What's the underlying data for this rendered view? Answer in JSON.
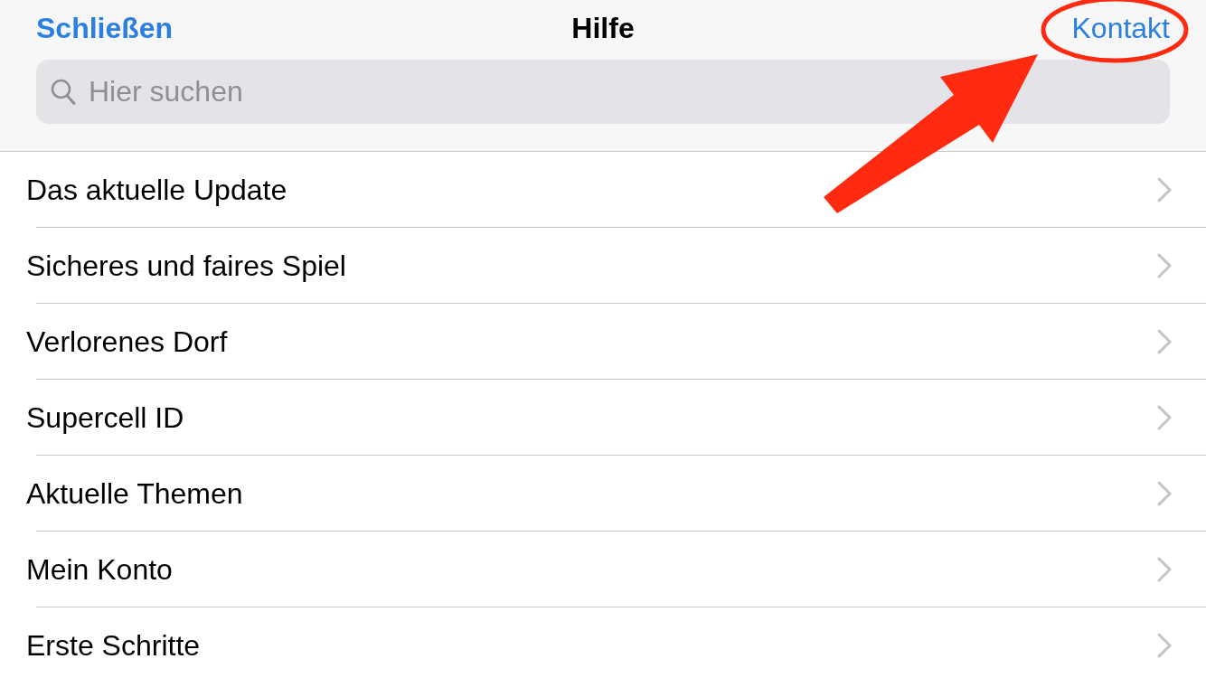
{
  "nav": {
    "close": "Schließen",
    "title": "Hilfe",
    "contact": "Kontakt"
  },
  "search": {
    "placeholder": "Hier suchen"
  },
  "items": [
    {
      "label": "Das aktuelle Update"
    },
    {
      "label": "Sicheres und faires Spiel"
    },
    {
      "label": "Verlorenes Dorf"
    },
    {
      "label": "Supercell ID"
    },
    {
      "label": "Aktuelle Themen"
    },
    {
      "label": "Mein Konto"
    },
    {
      "label": "Erste Schritte"
    }
  ]
}
